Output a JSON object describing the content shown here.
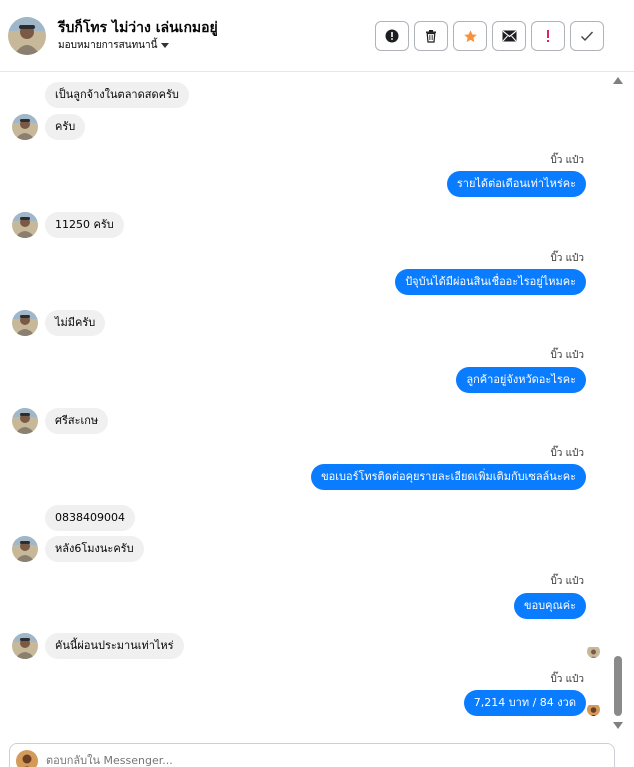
{
  "header": {
    "name": "รีบก็โทร ไม่ว่าง เล่นเกมอยู่",
    "assign_label": "มอบหมายการสนทนานี้"
  },
  "toolbar": {
    "buttons": [
      {
        "name": "alert",
        "icon": "exclamation-circle-icon"
      },
      {
        "name": "delete",
        "icon": "trash-icon"
      },
      {
        "name": "star",
        "icon": "star-icon",
        "color": "#f7923b"
      },
      {
        "name": "email",
        "icon": "envelope-icon"
      },
      {
        "name": "spam",
        "icon": "exclamation-icon",
        "color": "#e0245e"
      },
      {
        "name": "done",
        "icon": "check-icon"
      }
    ]
  },
  "thread": {
    "agent_name": "บิ๊ว แป๋ว",
    "messages": [
      {
        "from": "customer",
        "text": "เป็นลูกจ้างในตลาดสดครับ"
      },
      {
        "from": "customer",
        "text": "ครับ"
      },
      {
        "from": "agent",
        "text": "รายได้ต่อเดือนเท่าไหร่คะ"
      },
      {
        "from": "customer",
        "text": "11250 ครับ"
      },
      {
        "from": "agent",
        "text": "ปัจุบันได้มีผ่อนสินเชื่ออะไรอยู่ไหมคะ"
      },
      {
        "from": "customer",
        "text": "ไม่มีครับ"
      },
      {
        "from": "agent",
        "text": "ลูกค้าอยู่จังหวัดอะไรคะ"
      },
      {
        "from": "customer",
        "text": "ศรีสะเกษ"
      },
      {
        "from": "agent",
        "text": "ขอเบอร์โทรติดต่อคุยรายละเอียดเพิ่มเติมกับเซลล์นะคะ"
      },
      {
        "from": "customer",
        "text": "0838409004"
      },
      {
        "from": "customer",
        "text": "หลัง6โมงนะครับ"
      },
      {
        "from": "agent",
        "text": "ขอบคุณค่ะ"
      },
      {
        "from": "customer",
        "text": "คันนี้ผ่อนประมานเท่าไหร่"
      },
      {
        "from": "agent",
        "text": "7,214 บาท  / 84 งวด"
      }
    ]
  },
  "composer": {
    "placeholder": "ตอบกลับใน Messenger..."
  },
  "colors": {
    "outgoing_bubble": "#0a7cff",
    "incoming_bubble": "#f0f0f0"
  }
}
